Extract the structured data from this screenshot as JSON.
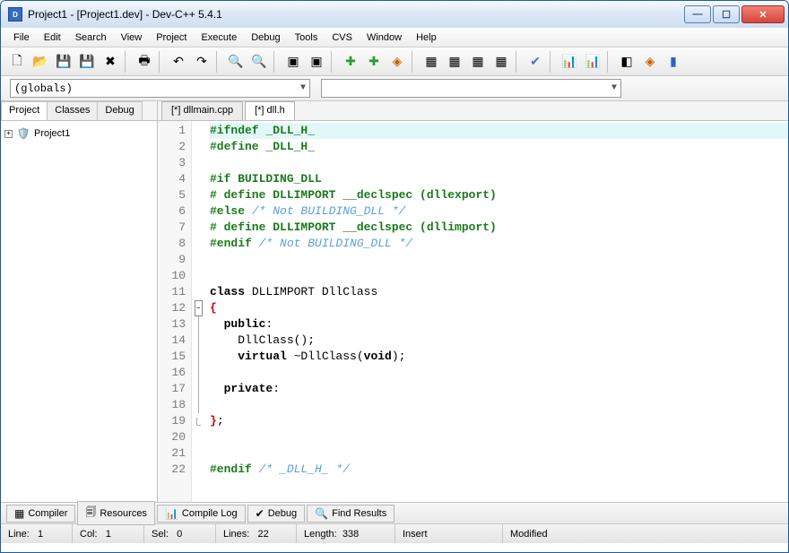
{
  "window": {
    "title": "Project1 - [Project1.dev] - Dev-C++ 5.4.1"
  },
  "menu": [
    "File",
    "Edit",
    "Search",
    "View",
    "Project",
    "Execute",
    "Debug",
    "Tools",
    "CVS",
    "Window",
    "Help"
  ],
  "combos": {
    "scope": "(globals)",
    "member": ""
  },
  "leftTabs": [
    "Project",
    "Classes",
    "Debug"
  ],
  "projectName": "Project1",
  "fileTabs": [
    {
      "label": "[*] dllmain.cpp",
      "active": false
    },
    {
      "label": "[*] dll.h",
      "active": true
    }
  ],
  "code": [
    {
      "n": 1,
      "hl": true,
      "segs": [
        {
          "t": "#ifndef _DLL_H_",
          "c": "kw-pre"
        }
      ]
    },
    {
      "n": 2,
      "segs": [
        {
          "t": "#define _DLL_H_",
          "c": "kw-pre"
        }
      ]
    },
    {
      "n": 3,
      "segs": []
    },
    {
      "n": 4,
      "segs": [
        {
          "t": "#if BUILDING_DLL",
          "c": "kw-pre"
        }
      ]
    },
    {
      "n": 5,
      "segs": [
        {
          "t": "# define DLLIMPORT __declspec (dllexport)",
          "c": "kw-pre"
        }
      ]
    },
    {
      "n": 6,
      "segs": [
        {
          "t": "#else ",
          "c": "kw-pre"
        },
        {
          "t": "/* Not BUILDING_DLL */",
          "c": "cmt"
        }
      ]
    },
    {
      "n": 7,
      "segs": [
        {
          "t": "# define DLLIMPORT __declspec (dllimport)",
          "c": "kw-pre"
        }
      ]
    },
    {
      "n": 8,
      "segs": [
        {
          "t": "#endif ",
          "c": "kw-pre"
        },
        {
          "t": "/* Not BUILDING_DLL */",
          "c": "cmt"
        }
      ]
    },
    {
      "n": 9,
      "segs": []
    },
    {
      "n": 10,
      "segs": []
    },
    {
      "n": 11,
      "segs": [
        {
          "t": "class",
          "c": "kw"
        },
        {
          "t": " DLLIMPORT DllClass"
        }
      ]
    },
    {
      "n": 12,
      "fold": "minus",
      "segs": [
        {
          "t": "{",
          "c": "brace"
        }
      ]
    },
    {
      "n": 13,
      "foldline": true,
      "segs": [
        {
          "t": "  "
        },
        {
          "t": "public",
          "c": "kw"
        },
        {
          "t": ":"
        }
      ]
    },
    {
      "n": 14,
      "foldline": true,
      "segs": [
        {
          "t": "    DllClass();"
        }
      ]
    },
    {
      "n": 15,
      "foldline": true,
      "segs": [
        {
          "t": "    "
        },
        {
          "t": "virtual",
          "c": "kw"
        },
        {
          "t": " ~DllClass("
        },
        {
          "t": "void",
          "c": "kw"
        },
        {
          "t": ");"
        }
      ]
    },
    {
      "n": 16,
      "foldline": true,
      "segs": []
    },
    {
      "n": 17,
      "foldline": true,
      "segs": [
        {
          "t": "  "
        },
        {
          "t": "private",
          "c": "kw"
        },
        {
          "t": ":"
        }
      ]
    },
    {
      "n": 18,
      "foldline": true,
      "segs": []
    },
    {
      "n": 19,
      "foldend": true,
      "segs": [
        {
          "t": "}",
          "c": "brace"
        },
        {
          "t": ";"
        }
      ]
    },
    {
      "n": 20,
      "segs": []
    },
    {
      "n": 21,
      "segs": []
    },
    {
      "n": 22,
      "segs": [
        {
          "t": "#endif ",
          "c": "kw-pre"
        },
        {
          "t": "/* _DLL_H_ */",
          "c": "cmt"
        }
      ]
    }
  ],
  "bottomTabs": [
    {
      "icon": "▦",
      "label": "Compiler"
    },
    {
      "icon": "🗐",
      "label": "Resources"
    },
    {
      "icon": "📊",
      "label": "Compile Log"
    },
    {
      "icon": "✔",
      "label": "Debug"
    },
    {
      "icon": "🔍",
      "label": "Find Results"
    }
  ],
  "status": {
    "line_label": "Line:",
    "line": "1",
    "col_label": "Col:",
    "col": "1",
    "sel_label": "Sel:",
    "sel": "0",
    "lines_label": "Lines:",
    "lines": "22",
    "length_label": "Length:",
    "length": "338",
    "insert": "Insert",
    "modified": "Modified"
  }
}
